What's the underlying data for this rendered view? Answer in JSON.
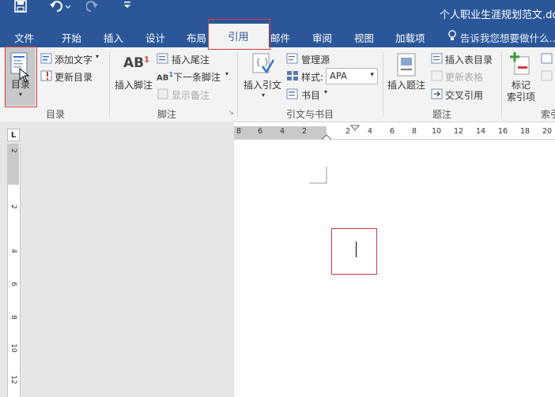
{
  "window": {
    "title": "个人职业生涯规划范文.doc"
  },
  "qat": {
    "save_icon": "save-icon",
    "undo_icon": "undo-icon",
    "redo_icon": "redo-icon",
    "customize_icon": "qat-customize-icon"
  },
  "tabs": [
    "文件",
    "开始",
    "插入",
    "设计",
    "布局",
    "引用",
    "邮件",
    "审阅",
    "视图",
    "加载项"
  ],
  "active_tab": "引用",
  "tell_me": "告诉我您想要做什么...",
  "ribbon": {
    "toc": {
      "button": "目录",
      "add_text": "添加文字",
      "update": "更新目录",
      "group": "目录"
    },
    "footnotes": {
      "insert_footnote": "插入脚注",
      "insert_endnote": "插入尾注",
      "next_footnote": "下一条脚注",
      "show_notes": "显示备注",
      "group": "脚注"
    },
    "citations": {
      "insert_citation": "插入引文",
      "manage_sources": "管理源",
      "style_label": "样式:",
      "style_value": "APA",
      "bibliography": "书目",
      "group": "引文与书目"
    },
    "captions": {
      "insert_caption": "插入题注",
      "insert_table_of_figures": "插入表目录",
      "update_table": "更新表格",
      "cross_reference": "交叉引用",
      "group": "题注"
    },
    "index": {
      "mark_entry_line1": "标记",
      "mark_entry_line2": "索引项",
      "group": "索引"
    }
  },
  "ruler": {
    "top_left": [
      "8",
      "6",
      "4",
      "2"
    ],
    "top_right": [
      "2",
      "4",
      "6",
      "8",
      "10",
      "12",
      "14",
      "16",
      "18",
      "20"
    ],
    "left": [
      "2",
      "2",
      "4",
      "6",
      "8",
      "10",
      "12"
    ]
  },
  "colors": {
    "accent": "#2b579a",
    "highlight": "#d23b3b"
  }
}
